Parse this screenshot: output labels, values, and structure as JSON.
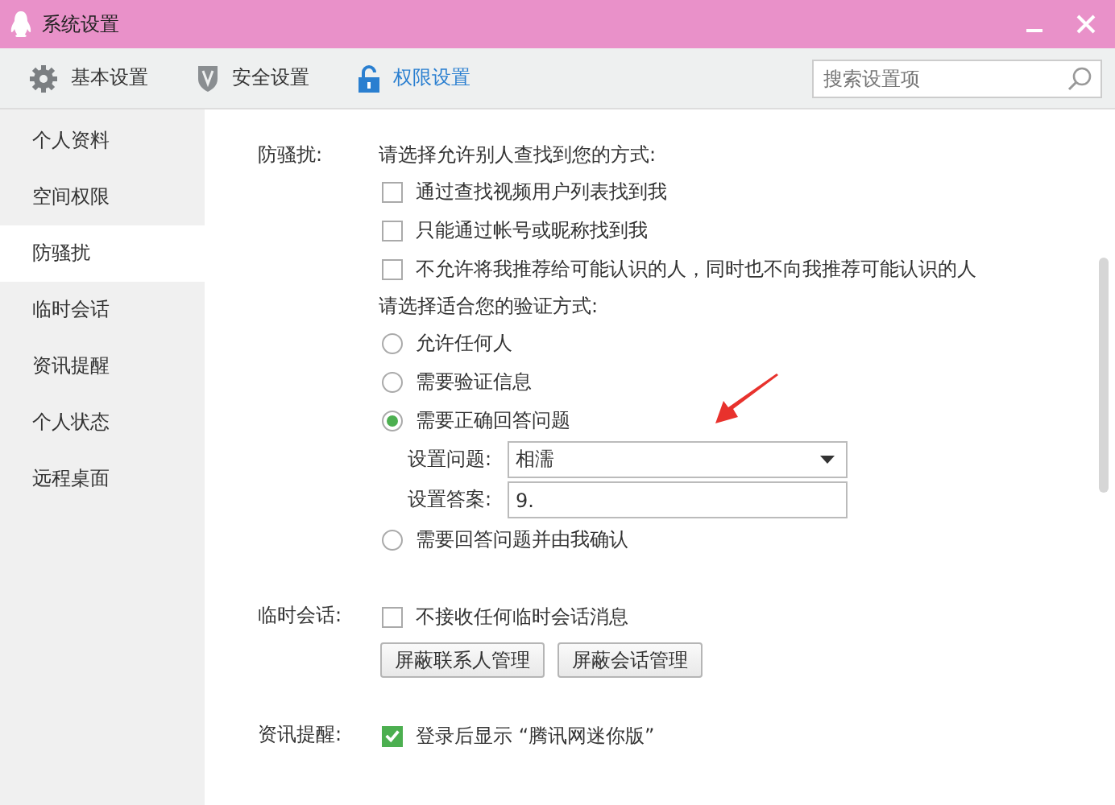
{
  "window": {
    "title": "系统设置"
  },
  "tabs": [
    {
      "label": "基本设置",
      "selected": false
    },
    {
      "label": "安全设置",
      "selected": false
    },
    {
      "label": "权限设置",
      "selected": true
    }
  ],
  "search": {
    "placeholder": "搜索设置项"
  },
  "sidebar": {
    "items": [
      {
        "label": "个人资料",
        "selected": false
      },
      {
        "label": "空间权限",
        "selected": false
      },
      {
        "label": "防骚扰",
        "selected": true
      },
      {
        "label": "临时会话",
        "selected": false
      },
      {
        "label": "资讯提醒",
        "selected": false
      },
      {
        "label": "个人状态",
        "selected": false
      },
      {
        "label": "远程桌面",
        "selected": false
      }
    ]
  },
  "sections": [
    {
      "label": "防骚扰:",
      "items": [
        {
          "kind": "text",
          "text": "请选择允许别人查找到您的方式:"
        },
        {
          "kind": "checkbox",
          "text": "通过查找视频用户列表找到我",
          "checked": false
        },
        {
          "kind": "checkbox",
          "text": "只能通过帐号或昵称找到我",
          "checked": false
        },
        {
          "kind": "checkbox",
          "text": "不允许将我推荐给可能认识的人，同时也不向我推荐可能认识的人",
          "checked": false
        },
        {
          "kind": "text",
          "text": "请选择适合您的验证方式:"
        },
        {
          "kind": "radio",
          "text": "允许任何人",
          "selected": false
        },
        {
          "kind": "radio",
          "text": "需要验证信息",
          "selected": false
        },
        {
          "kind": "radio",
          "text": "需要正确回答问题",
          "selected": true
        },
        {
          "kind": "dropdown",
          "text": "设置问题:",
          "value": "相濡"
        },
        {
          "kind": "input",
          "text": "设置答案:",
          "value": "9."
        },
        {
          "kind": "radio",
          "text": "需要回答问题并由我确认",
          "selected": false
        }
      ]
    },
    {
      "label": "临时会话:",
      "items": [
        {
          "kind": "checkbox",
          "text": "不接收任何临时会话消息",
          "checked": false
        },
        {
          "kind": "buttons",
          "buttons": [
            "屏蔽联系人管理",
            "屏蔽会话管理"
          ]
        }
      ]
    },
    {
      "label": "资讯提醒:",
      "items": [
        {
          "kind": "checkbox",
          "text": "登录后显示 “腾讯网迷你版”",
          "checked": true
        }
      ]
    }
  ]
}
